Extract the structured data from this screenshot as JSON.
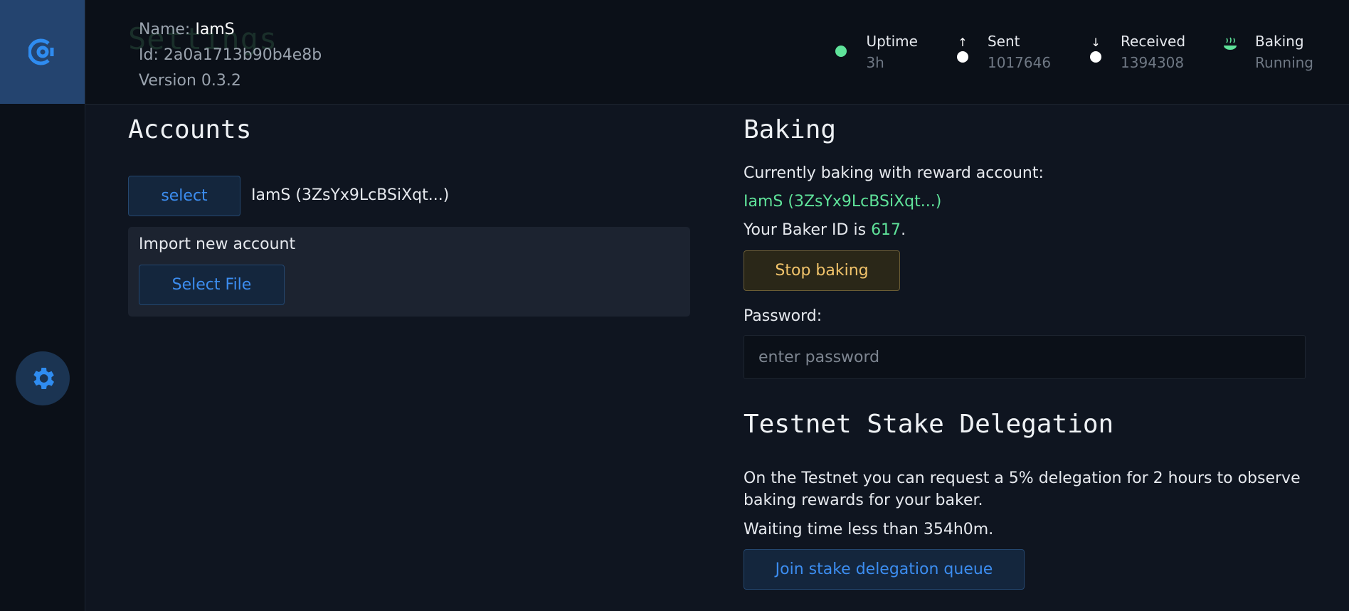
{
  "header": {
    "ghost_title": "Settings",
    "name_label": "Name:",
    "name_value": "IamS",
    "id_line": "Id: 2a0a1713b90b4e8b",
    "version_line": "Version 0.3.2",
    "stats": [
      {
        "label": "Uptime",
        "value": "3h",
        "icon": "status-dot-icon"
      },
      {
        "label": "Sent",
        "value": "1017646",
        "icon": "arrow-up-icon"
      },
      {
        "label": "Received",
        "value": "1394308",
        "icon": "arrow-down-icon"
      },
      {
        "label": "Baking",
        "value": "Running",
        "icon": "baking-steam-icon"
      }
    ]
  },
  "accounts": {
    "title": "Accounts",
    "select_button": "select",
    "current_account": "IamS (3ZsYx9LcBSiXqt...)",
    "import_label": "Import new account",
    "select_file_button": "Select File"
  },
  "baking": {
    "title": "Baking",
    "status_line": "Currently baking with reward account:",
    "reward_account": "IamS (3ZsYx9LcBSiXqt...)",
    "baker_id_prefix": "Your Baker ID is ",
    "baker_id": "617",
    "baker_id_suffix": ".",
    "stop_button": "Stop baking",
    "password_label": "Password:",
    "password_placeholder": "enter password"
  },
  "delegation": {
    "title": "Testnet Stake Delegation",
    "description_line1": "On the Testnet you can request a 5% delegation for 2 hours to observe",
    "description_line2": "baking rewards for your baker.",
    "waiting_text": "Waiting time less than 354h0m.",
    "join_button": "Join stake delegation queue"
  },
  "colors": {
    "accent_blue": "#3c8df0",
    "success_green": "#5fe39a",
    "warning_gold": "#f2c46b",
    "background": "#0f1520"
  }
}
